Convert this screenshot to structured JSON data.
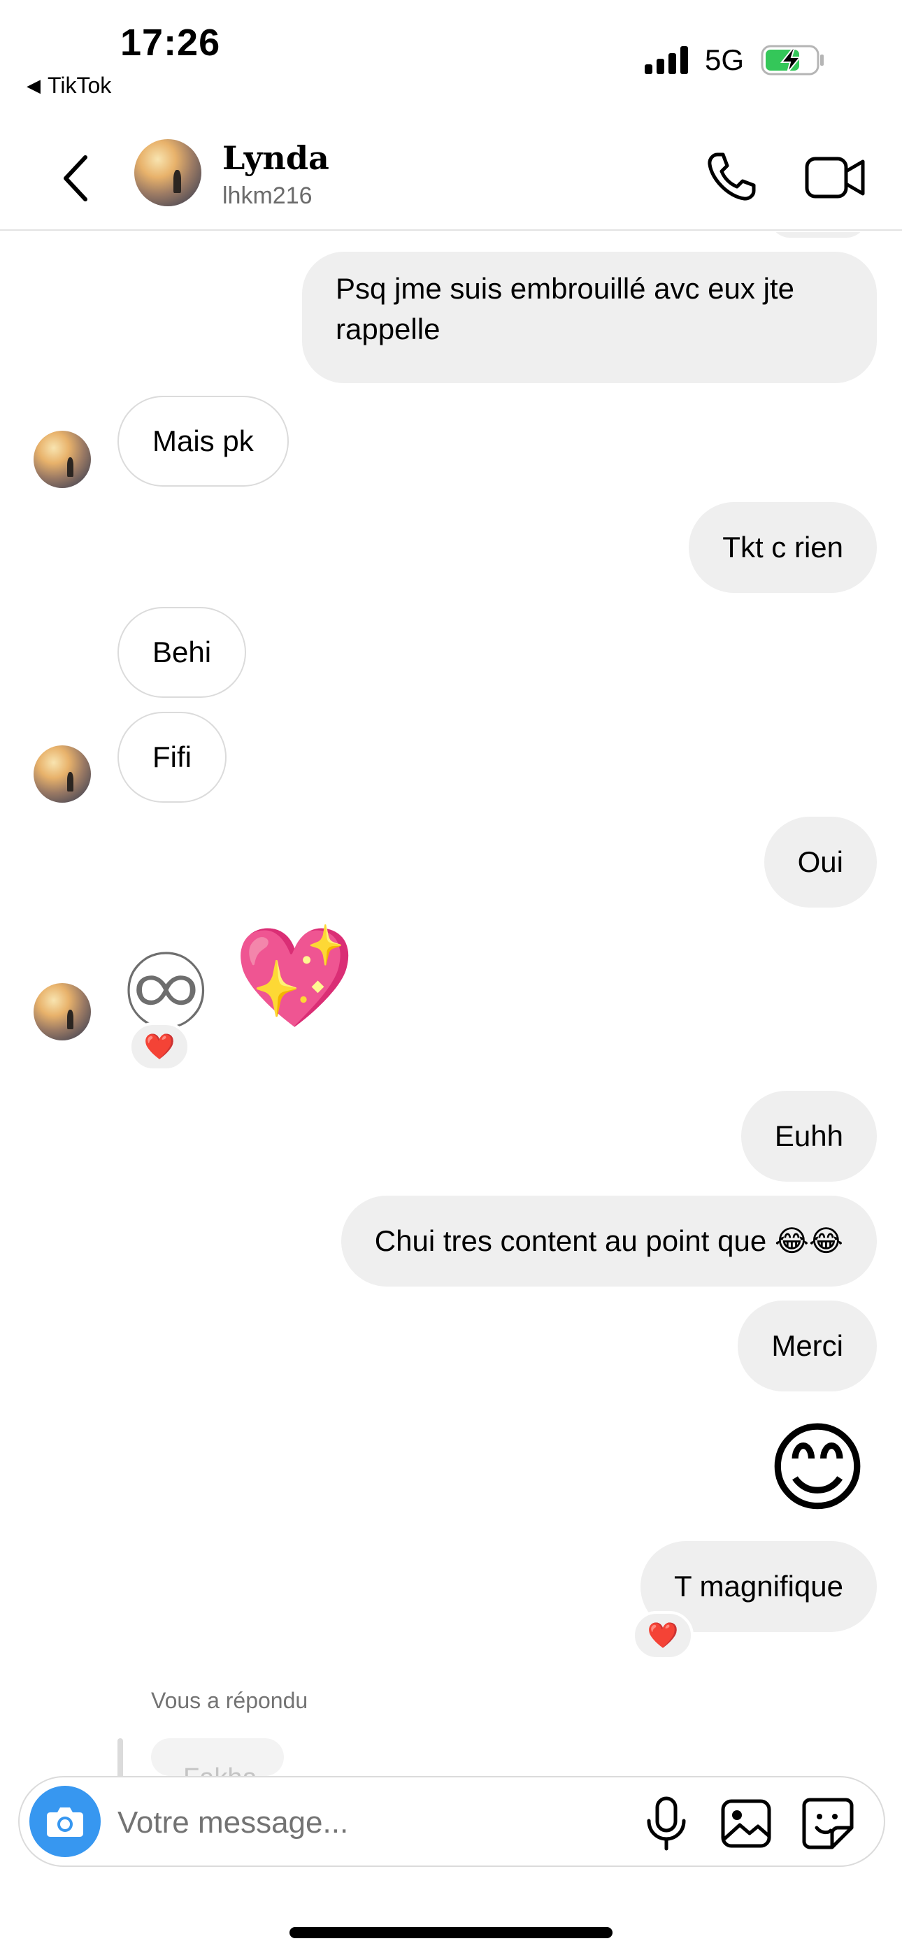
{
  "status_bar": {
    "time": "17:26",
    "back_app": "TikTok",
    "network": "5G",
    "battery_icon": "battery-charging-icon",
    "battery_color": "#34c759"
  },
  "header": {
    "name": "Lynda",
    "username": "lhkm216",
    "icons": [
      "chevron-left-icon",
      "phone-icon",
      "video-camera-icon"
    ]
  },
  "messages": [
    {
      "text": "Psq jme suis embrouillé avc eux jte rappelle",
      "direction": "out"
    },
    {
      "text": "Mais pk",
      "direction": "in"
    },
    {
      "text": "Tkt c rien",
      "direction": "out"
    },
    {
      "text": "Behi",
      "direction": "in"
    },
    {
      "text": "Fifi",
      "direction": "in"
    },
    {
      "text": "Oui",
      "direction": "out"
    },
    {
      "text": "♾️💖",
      "direction": "in",
      "reaction": "❤️"
    },
    {
      "text": "Euhh",
      "direction": "out"
    },
    {
      "text": "Chui tres content au point que 😂😂",
      "direction": "out"
    },
    {
      "text": "Merci",
      "direction": "out"
    },
    {
      "text": "😊",
      "direction": "out"
    },
    {
      "text": "T magnifique",
      "direction": "out",
      "reaction": "❤️"
    }
  ],
  "emoji": {
    "infinity": "♾",
    "sparkling_heart": "💖",
    "smile": "😊",
    "reaction_heart": "❤️"
  },
  "reply": {
    "label": "Vous a répondu",
    "preview": "Fakha"
  },
  "composer": {
    "placeholder": "Votre message...",
    "accent_color": "#3797f0"
  }
}
